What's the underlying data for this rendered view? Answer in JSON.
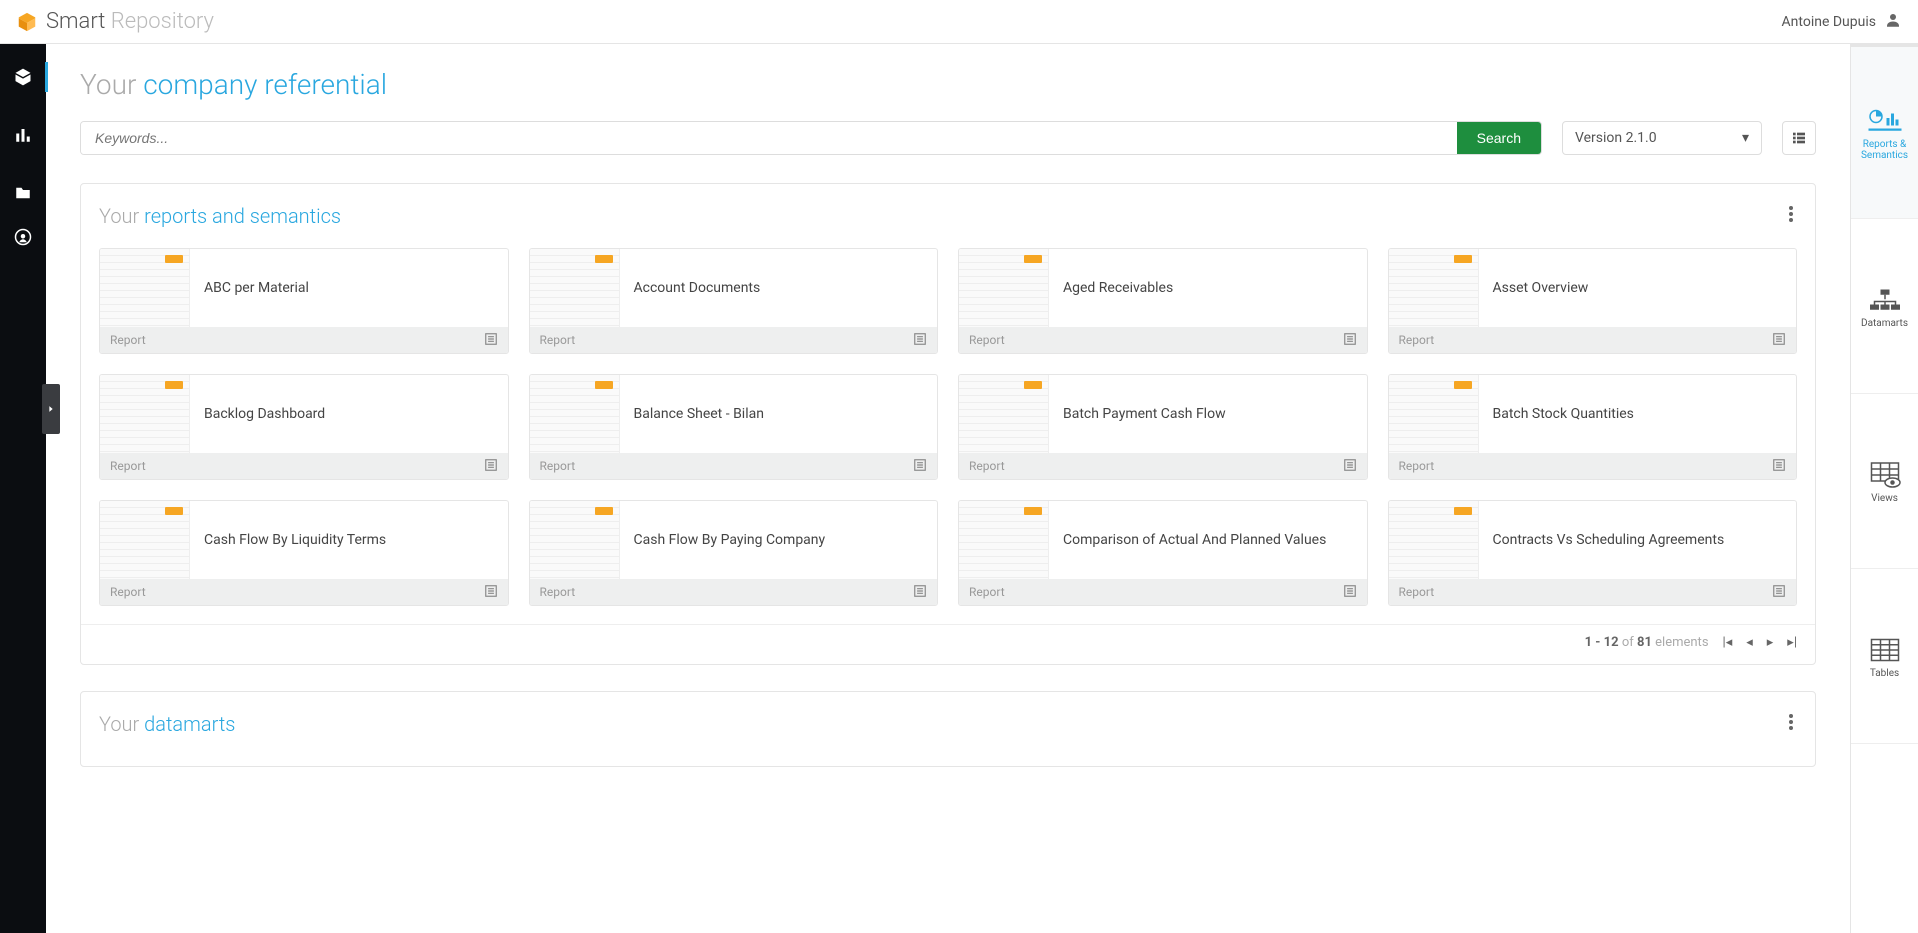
{
  "brand": {
    "part1": "Smart",
    "part2": "Repository"
  },
  "user": {
    "name": "Antoine Dupuis"
  },
  "page_title": {
    "prefix": "Your ",
    "accent": "company referential"
  },
  "search": {
    "placeholder": "Keywords...",
    "button": "Search",
    "version": "Version 2.1.0"
  },
  "right_nav": [
    {
      "label": "Reports & Semantics",
      "active": true
    },
    {
      "label": "Datamarts",
      "active": false
    },
    {
      "label": "Views",
      "active": false
    },
    {
      "label": "Tables",
      "active": false
    }
  ],
  "sections": {
    "reports": {
      "prefix": "Your ",
      "accent": "reports and semantics",
      "footer_label": "Report",
      "cards": [
        {
          "title": "ABC per Material"
        },
        {
          "title": "Account Documents"
        },
        {
          "title": "Aged Receivables"
        },
        {
          "title": "Asset Overview"
        },
        {
          "title": "Backlog Dashboard"
        },
        {
          "title": "Balance Sheet - Bilan"
        },
        {
          "title": "Batch Payment Cash Flow"
        },
        {
          "title": "Batch Stock Quantities"
        },
        {
          "title": "Cash Flow By Liquidity Terms"
        },
        {
          "title": "Cash Flow By Paying Company"
        },
        {
          "title": "Comparison of Actual And Planned Values"
        },
        {
          "title": "Contracts Vs Scheduling Agreements"
        }
      ],
      "pagination": {
        "range": "1 - 12",
        "of": "of",
        "total": "81",
        "suffix": "elements"
      }
    },
    "datamarts": {
      "prefix": "Your ",
      "accent": "datamarts"
    }
  }
}
